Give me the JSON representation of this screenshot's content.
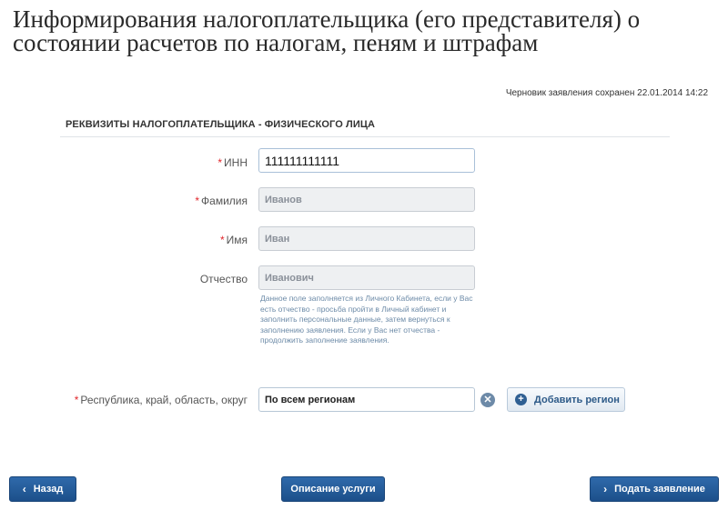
{
  "header": {
    "title": "Информирования налогоплательщика (его представителя) о состоянии расчетов по налогам, пеням и штрафам",
    "draft_status": "Черновик заявления сохранен 22.01.2014 14:22"
  },
  "section": {
    "title": "РЕКВИЗИТЫ НАЛОГОПЛАТЕЛЬЩИКА - ФИЗИЧЕСКОГО ЛИЦА"
  },
  "form": {
    "required_mark": "*",
    "inn": {
      "label": "ИНН",
      "value": "111111111111"
    },
    "last_name": {
      "label": "Фамилия",
      "value": "Иванов"
    },
    "first_name": {
      "label": "Имя",
      "value": "Иван"
    },
    "middle_name": {
      "label": "Отчество",
      "value": "Иванович",
      "hint": "Данное поле заполняется из Личного Кабинета, если у Вас есть отчество - просьба пройти в Личный кабинет и заполнить персональные данные, затем вернуться к заполнению заявления. Если у Вас нет отчества - продолжить заполнение заявления."
    },
    "region": {
      "label": "Республика, край, область, округ",
      "value": "По всем регионам",
      "add_label": "Добавить регион"
    }
  },
  "footer": {
    "back_label": "Назад",
    "service_label": "Описание услуги",
    "submit_label": "Подать заявление"
  },
  "colors": {
    "primary": "#1c4f8a",
    "required": "#e0262b",
    "hint": "#6d8ba8"
  },
  "icons": {
    "back": "chevron-left-icon",
    "submit": "chevron-right-icon",
    "add": "plus-circle-icon",
    "clear": "clear-x-icon"
  }
}
